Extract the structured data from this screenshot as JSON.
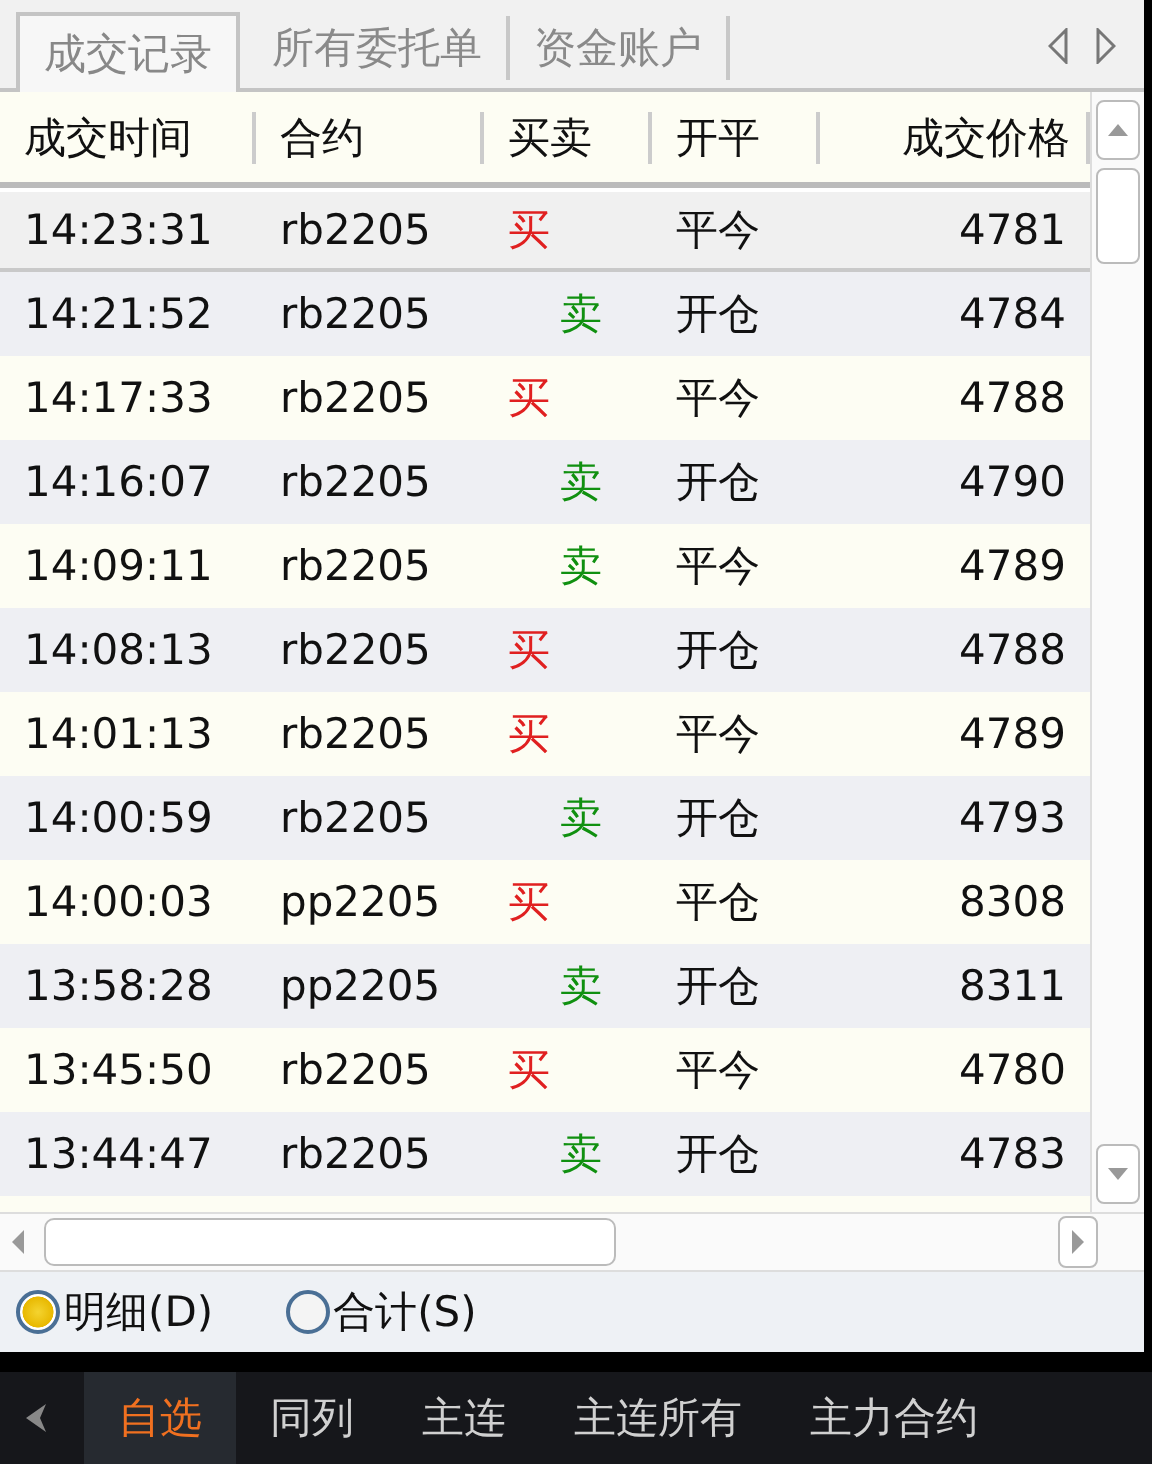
{
  "tabs": [
    {
      "label": "成交记录",
      "selected": true
    },
    {
      "label": "所有委托单",
      "selected": false
    },
    {
      "label": "资金账户",
      "selected": false
    }
  ],
  "table": {
    "columns": [
      "成交时间",
      "合约",
      "买卖",
      "开平",
      "成交价格"
    ],
    "rows": [
      {
        "time": "14:23:31",
        "contract": "rb2205",
        "side": "买",
        "kind": "buy",
        "offset": "平今",
        "price": "4781",
        "selected": true
      },
      {
        "time": "14:21:52",
        "contract": "rb2205",
        "side": "卖",
        "kind": "sell",
        "offset": "开仓",
        "price": "4784",
        "selected": false
      },
      {
        "time": "14:17:33",
        "contract": "rb2205",
        "side": "买",
        "kind": "buy",
        "offset": "平今",
        "price": "4788",
        "selected": false
      },
      {
        "time": "14:16:07",
        "contract": "rb2205",
        "side": "卖",
        "kind": "sell",
        "offset": "开仓",
        "price": "4790",
        "selected": false
      },
      {
        "time": "14:09:11",
        "contract": "rb2205",
        "side": "卖",
        "kind": "sell",
        "offset": "平今",
        "price": "4789",
        "selected": false
      },
      {
        "time": "14:08:13",
        "contract": "rb2205",
        "side": "买",
        "kind": "buy",
        "offset": "开仓",
        "price": "4788",
        "selected": false
      },
      {
        "time": "14:01:13",
        "contract": "rb2205",
        "side": "买",
        "kind": "buy",
        "offset": "平今",
        "price": "4789",
        "selected": false
      },
      {
        "time": "14:00:59",
        "contract": "rb2205",
        "side": "卖",
        "kind": "sell",
        "offset": "开仓",
        "price": "4793",
        "selected": false
      },
      {
        "time": "14:00:03",
        "contract": "pp2205",
        "side": "买",
        "kind": "buy",
        "offset": "平仓",
        "price": "8308",
        "selected": false
      },
      {
        "time": "13:58:28",
        "contract": "pp2205",
        "side": "卖",
        "kind": "sell",
        "offset": "开仓",
        "price": "8311",
        "selected": false
      },
      {
        "time": "13:45:50",
        "contract": "rb2205",
        "side": "买",
        "kind": "buy",
        "offset": "平今",
        "price": "4780",
        "selected": false
      },
      {
        "time": "13:44:47",
        "contract": "rb2205",
        "side": "卖",
        "kind": "sell",
        "offset": "开仓",
        "price": "4783",
        "selected": false
      }
    ]
  },
  "view_options": [
    {
      "label": "明细(D)",
      "selected": true
    },
    {
      "label": "合计(S)",
      "selected": false
    }
  ],
  "bottom_tabs": [
    {
      "label": "自选",
      "selected": true
    },
    {
      "label": "同列",
      "selected": false
    },
    {
      "label": "主连",
      "selected": false
    },
    {
      "label": "主连所有",
      "selected": false
    },
    {
      "label": "主力合约",
      "selected": false
    }
  ]
}
